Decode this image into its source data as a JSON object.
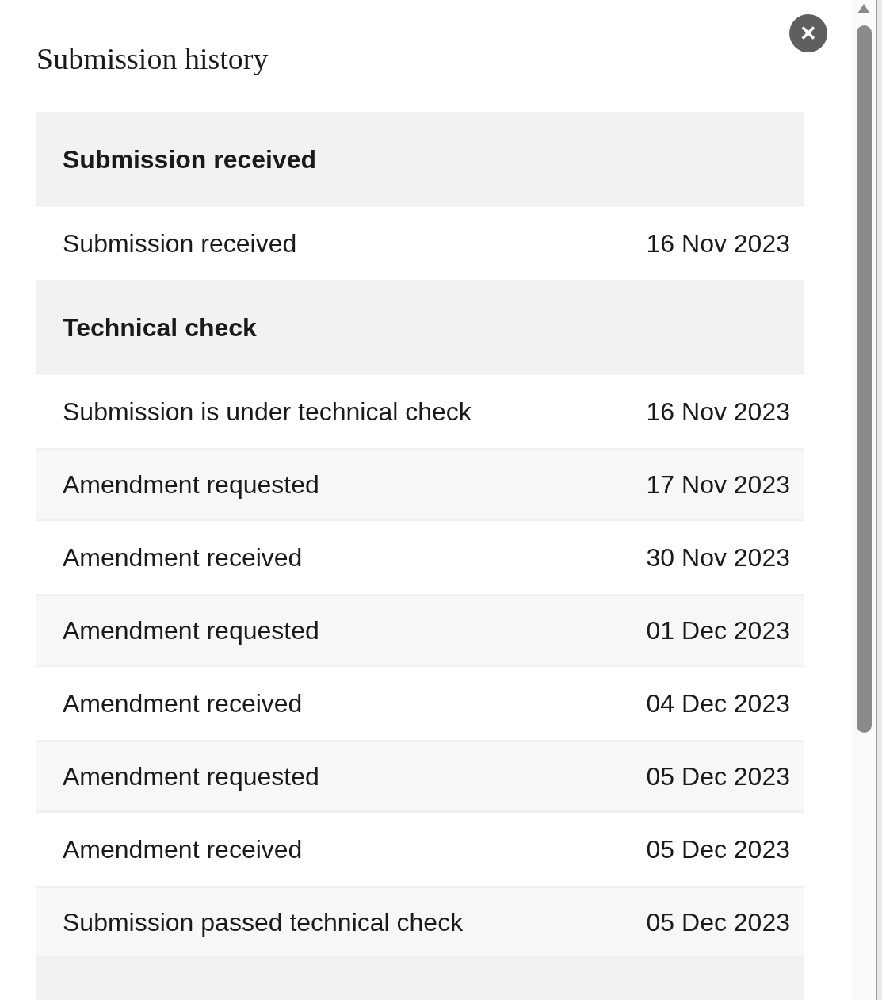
{
  "dialog": {
    "title": "Submission history",
    "close_label": "✕"
  },
  "history": [
    {
      "kind": "section",
      "label": "Submission received"
    },
    {
      "kind": "event",
      "label": "Submission received",
      "date": "16 Nov 2023"
    },
    {
      "kind": "section",
      "label": "Technical check"
    },
    {
      "kind": "event",
      "label": "Submission is under technical check",
      "date": "16 Nov 2023"
    },
    {
      "kind": "event",
      "label": "Amendment requested",
      "date": "17 Nov 2023"
    },
    {
      "kind": "event",
      "label": "Amendment received",
      "date": "30 Nov 2023"
    },
    {
      "kind": "event",
      "label": "Amendment requested",
      "date": "01 Dec 2023"
    },
    {
      "kind": "event",
      "label": "Amendment received",
      "date": "04 Dec 2023"
    },
    {
      "kind": "event",
      "label": "Amendment requested",
      "date": "05 Dec 2023"
    },
    {
      "kind": "event",
      "label": "Amendment received",
      "date": "05 Dec 2023"
    },
    {
      "kind": "event",
      "label": "Submission passed technical check",
      "date": "05 Dec 2023"
    }
  ]
}
